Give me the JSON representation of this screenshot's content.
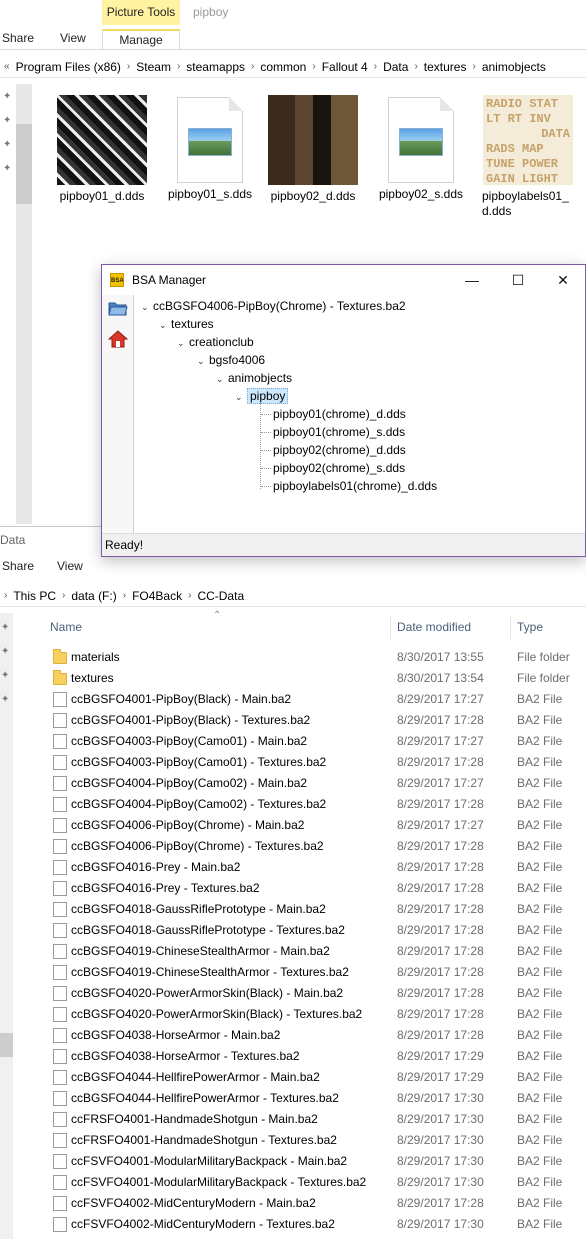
{
  "top_window": {
    "contextual_group": "Picture Tools",
    "window_title": "pipboy",
    "tabs": {
      "share": "Share",
      "view": "View",
      "manage": "Manage"
    },
    "breadcrumb": [
      "Program Files (x86)",
      "Steam",
      "steamapps",
      "common",
      "Fallout 4",
      "Data",
      "textures",
      "animobjects"
    ],
    "overflow_glyph": "«",
    "thumbnails": [
      {
        "label": "pipboy01_d.dds",
        "kind": "texture-dark"
      },
      {
        "label": "pipboy01_s.dds",
        "kind": "generic-image"
      },
      {
        "label": "pipboy02_d.dds",
        "kind": "texture-brown"
      },
      {
        "label": "pipboy02_s.dds",
        "kind": "generic-image"
      },
      {
        "label": "pipboylabels01_d.dds",
        "kind": "texture-labels"
      }
    ],
    "labels_texture_text": [
      "RADIO STAT",
      "LT  RT  INV",
      "DATA",
      "RADS   MAP",
      "TUNE POWER",
      "GAIN LIGHT"
    ]
  },
  "bsa_manager": {
    "title": "BSA Manager",
    "logo_text": "BSA",
    "window_controls": {
      "minimize": "—",
      "maximize": "☐",
      "close": "✕"
    },
    "tree": {
      "root": "ccBGSFO4006-PipBoy(Chrome) - Textures.ba2",
      "textures": "textures",
      "creationclub": "creationclub",
      "bgsfo4006": "bgsfo4006",
      "animobjects": "animobjects",
      "pipboy": "pipboy",
      "files": [
        "pipboy01(chrome)_d.dds",
        "pipboy01(chrome)_s.dds",
        "pipboy02(chrome)_d.dds",
        "pipboy02(chrome)_s.dds",
        "pipboylabels01(chrome)_d.dds"
      ]
    },
    "status": "Ready!"
  },
  "bottom_window": {
    "title": "Data",
    "tabs": {
      "share": "Share",
      "view": "View"
    },
    "breadcrumb": [
      "This PC",
      "data (F:)",
      "FO4Back",
      "CC-Data"
    ],
    "columns": {
      "name": "Name",
      "date": "Date modified",
      "type": "Type"
    },
    "rows": [
      {
        "name": "materials",
        "date": "8/30/2017 13:55",
        "type": "File folder",
        "icon": "folder"
      },
      {
        "name": "textures",
        "date": "8/30/2017 13:54",
        "type": "File folder",
        "icon": "folder"
      },
      {
        "name": "ccBGSFO4001-PipBoy(Black) - Main.ba2",
        "date": "8/29/2017 17:27",
        "type": "BA2 File",
        "icon": "file"
      },
      {
        "name": "ccBGSFO4001-PipBoy(Black) - Textures.ba2",
        "date": "8/29/2017 17:28",
        "type": "BA2 File",
        "icon": "file"
      },
      {
        "name": "ccBGSFO4003-PipBoy(Camo01) - Main.ba2",
        "date": "8/29/2017 17:27",
        "type": "BA2 File",
        "icon": "file"
      },
      {
        "name": "ccBGSFO4003-PipBoy(Camo01) - Textures.ba2",
        "date": "8/29/2017 17:28",
        "type": "BA2 File",
        "icon": "file"
      },
      {
        "name": "ccBGSFO4004-PipBoy(Camo02) - Main.ba2",
        "date": "8/29/2017 17:27",
        "type": "BA2 File",
        "icon": "file"
      },
      {
        "name": "ccBGSFO4004-PipBoy(Camo02) - Textures.ba2",
        "date": "8/29/2017 17:28",
        "type": "BA2 File",
        "icon": "file"
      },
      {
        "name": "ccBGSFO4006-PipBoy(Chrome) - Main.ba2",
        "date": "8/29/2017 17:27",
        "type": "BA2 File",
        "icon": "file"
      },
      {
        "name": "ccBGSFO4006-PipBoy(Chrome) - Textures.ba2",
        "date": "8/29/2017 17:28",
        "type": "BA2 File",
        "icon": "file"
      },
      {
        "name": "ccBGSFO4016-Prey - Main.ba2",
        "date": "8/29/2017 17:28",
        "type": "BA2 File",
        "icon": "file"
      },
      {
        "name": "ccBGSFO4016-Prey - Textures.ba2",
        "date": "8/29/2017 17:28",
        "type": "BA2 File",
        "icon": "file"
      },
      {
        "name": "ccBGSFO4018-GaussRiflePrototype - Main.ba2",
        "date": "8/29/2017 17:28",
        "type": "BA2 File",
        "icon": "file"
      },
      {
        "name": "ccBGSFO4018-GaussRiflePrototype - Textures.ba2",
        "date": "8/29/2017 17:28",
        "type": "BA2 File",
        "icon": "file"
      },
      {
        "name": "ccBGSFO4019-ChineseStealthArmor - Main.ba2",
        "date": "8/29/2017 17:28",
        "type": "BA2 File",
        "icon": "file"
      },
      {
        "name": "ccBGSFO4019-ChineseStealthArmor - Textures.ba2",
        "date": "8/29/2017 17:28",
        "type": "BA2 File",
        "icon": "file"
      },
      {
        "name": "ccBGSFO4020-PowerArmorSkin(Black) - Main.ba2",
        "date": "8/29/2017 17:28",
        "type": "BA2 File",
        "icon": "file"
      },
      {
        "name": "ccBGSFO4020-PowerArmorSkin(Black) - Textures.ba2",
        "date": "8/29/2017 17:28",
        "type": "BA2 File",
        "icon": "file"
      },
      {
        "name": "ccBGSFO4038-HorseArmor - Main.ba2",
        "date": "8/29/2017 17:28",
        "type": "BA2 File",
        "icon": "file"
      },
      {
        "name": "ccBGSFO4038-HorseArmor - Textures.ba2",
        "date": "8/29/2017 17:29",
        "type": "BA2 File",
        "icon": "file"
      },
      {
        "name": "ccBGSFO4044-HellfirePowerArmor - Main.ba2",
        "date": "8/29/2017 17:29",
        "type": "BA2 File",
        "icon": "file"
      },
      {
        "name": "ccBGSFO4044-HellfirePowerArmor - Textures.ba2",
        "date": "8/29/2017 17:30",
        "type": "BA2 File",
        "icon": "file"
      },
      {
        "name": "ccFRSFO4001-HandmadeShotgun - Main.ba2",
        "date": "8/29/2017 17:30",
        "type": "BA2 File",
        "icon": "file"
      },
      {
        "name": "ccFRSFO4001-HandmadeShotgun - Textures.ba2",
        "date": "8/29/2017 17:30",
        "type": "BA2 File",
        "icon": "file"
      },
      {
        "name": "ccFSVFO4001-ModularMilitaryBackpack - Main.ba2",
        "date": "8/29/2017 17:30",
        "type": "BA2 File",
        "icon": "file"
      },
      {
        "name": "ccFSVFO4001-ModularMilitaryBackpack - Textures.ba2",
        "date": "8/29/2017 17:30",
        "type": "BA2 File",
        "icon": "file"
      },
      {
        "name": "ccFSVFO4002-MidCenturyModern - Main.ba2",
        "date": "8/29/2017 17:28",
        "type": "BA2 File",
        "icon": "file"
      },
      {
        "name": "ccFSVFO4002-MidCenturyModern - Textures.ba2",
        "date": "8/29/2017 17:30",
        "type": "BA2 File",
        "icon": "file"
      }
    ]
  },
  "colors": {
    "contextual_tab": "#fff2a0",
    "selection": "#cce8ff",
    "bsa_border": "#7d5ba6",
    "header_text": "#4c607a"
  }
}
